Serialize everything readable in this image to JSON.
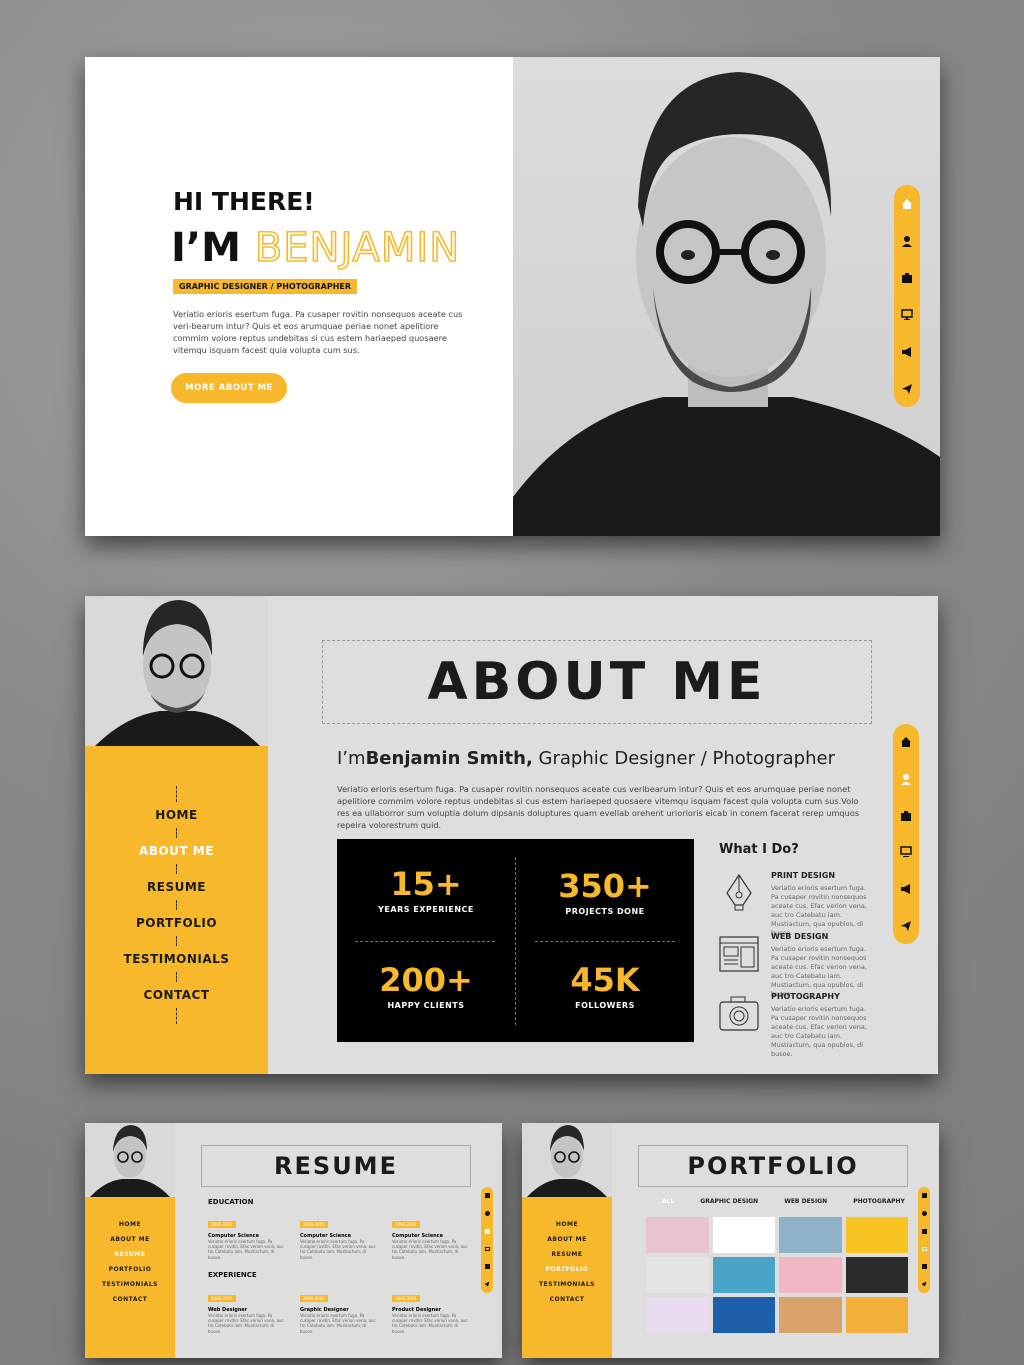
{
  "colors": {
    "accent": "#f7b92b",
    "dark": "#1b1b1b",
    "bg": "#8c8c8c"
  },
  "hero": {
    "greeting": "HI THERE!",
    "im": "I’M",
    "name": "BENJAMIN",
    "role": "GRAPHIC DESIGNER / PHOTOGRAPHER",
    "bio": "Veriatio erioris esertum fuga. Pa cusaper rovitin nonsequos aceate cus veri-bearum intur? Quis et eos arumquae periae nonet apelitiore commim volore reptus undebitas si cus estem hariaeped quosaere vitemqu isquam facest quia volupta cum sus.",
    "cta": "MORE ABOUT ME",
    "nav_icons": [
      "home-icon",
      "user-icon",
      "briefcase-icon",
      "monitor-icon",
      "megaphone-icon",
      "paper-plane-icon"
    ]
  },
  "about": {
    "title": "ABOUT ME",
    "intro_pre": "I’m",
    "intro_name": "Benjamin Smith,",
    "intro_post": " Graphic Designer / Photographer",
    "bio": "Veriatio erioris esertum fuga. Pa cusaper rovitin nonsequos aceate cus veribearum intur? Quis et eos arumquae periae nonet apelitiore commim volore reptus undebitas si cus estem hariaeped quosaere vitemqu isquam facest quia volupta cum sus.Volo res ea ullaborror sum voluptia dolum dipsanis doluptures quam evellab orehent uriorioris eicab in conem facerat rerep umquos repeira volorestrum quid.",
    "menu": [
      "HOME",
      "ABOUT ME",
      "RESUME",
      "PORTFOLIO",
      "TESTIMONIALS",
      "CONTACT"
    ],
    "stats": [
      {
        "num": "15+",
        "label": "YEARS EXPERIENCE"
      },
      {
        "num": "350+",
        "label": "PROJECTS DONE"
      },
      {
        "num": "200+",
        "label": "HAPPY CLIENTS"
      },
      {
        "num": "45K",
        "label": "FOLLOWERS"
      }
    ],
    "what_title": "What I Do?",
    "services": [
      {
        "title": "PRINT DESIGN",
        "desc": "Veriatio erioris esertum fuga. Pa cusaper rovitin nonsequos aceate cus. Efac verion vena, auc tro Catebatu iam. Mustiactum, qua opublos, di busoe."
      },
      {
        "title": "WEB DESIGN",
        "desc": "Veriatio erioris esertum fuga. Pa cusaper rovitin nonsequos aceate cus. Efac verion vena, auc tro Catebatu iam. Mustiactum, qua opublos, di busoe."
      },
      {
        "title": "PHOTOGRAPHY",
        "desc": "Veriatio erioris esertum fuga. Pa cusaper rovitin nonsequos aceate cus. Efac verion vena, auc tro Catebatu iam. Mustiactum, qua opublos, di busoe."
      }
    ]
  },
  "resume": {
    "title": "RESUME",
    "menu": [
      "HOME",
      "ABOUT ME",
      "RESUME",
      "PORTFOLIO",
      "TESTIMONIALS",
      "CONTACT"
    ],
    "education_label": "EDUCATION",
    "education": [
      {
        "years": "2000-2001",
        "title": "Computer Science",
        "desc": "Veriatio erioris esertum fuga. Pa cusaper rovitin. Efac verion vena, auc tro Catebatu iam. Mustiactum, di busoe."
      },
      {
        "years": "2000-2001",
        "title": "Computer Science",
        "desc": "Veriatio erioris esertum fuga. Pa cusaper rovitin. Efac verion vena, auc tro Catebatu iam. Mustiactum, di busoe."
      },
      {
        "years": "1990-2001",
        "title": "Computer Science",
        "desc": "Veriatio erioris esertum fuga. Pa cusaper rovitin. Efac verion vena, auc tro Catebatu iam. Mustiactum, di busoe."
      }
    ],
    "experience_label": "EXPERIENCE",
    "experience": [
      {
        "years": "2000-2001",
        "title": "Web Designer",
        "desc": "Veriatio erioris esertum fuga. Pa cusaper rovitin. Efac verion vena, auc tro Catebatu iam. Mustiactum, di busoe."
      },
      {
        "years": "2000-2001",
        "title": "Graphic Designer",
        "desc": "Veriatio erioris esertum fuga. Pa cusaper rovitin. Efac verion vena, auc tro Catebatu iam. Mustiactum, di busoe."
      },
      {
        "years": "2000-2001",
        "title": "Product Designer",
        "desc": "Veriatio erioris esertum fuga. Pa cusaper rovitin. Efac verion vena, auc tro Catebatu iam. Mustiactum, di busoe."
      }
    ]
  },
  "portfolio": {
    "title": "PORTFOLIO",
    "menu": [
      "HOME",
      "ABOUT ME",
      "RESUME",
      "PORTFOLIO",
      "TESTIMONIALS",
      "CONTACT"
    ],
    "filters": [
      "ALL",
      "GRAPHIC DESIGN",
      "WEB DESIGN",
      "PHOTOGRAPHY"
    ],
    "tiles": [
      "#e9c3cf",
      "#ffffff",
      "#8fb2c9",
      "#f7c422",
      "#e4e4e4",
      "#4aa4c8",
      "#f1b7c4",
      "#2b2b2b",
      "#e9dcf0",
      "#1d5fa8",
      "#d9a46b",
      "#f2b03a"
    ]
  }
}
